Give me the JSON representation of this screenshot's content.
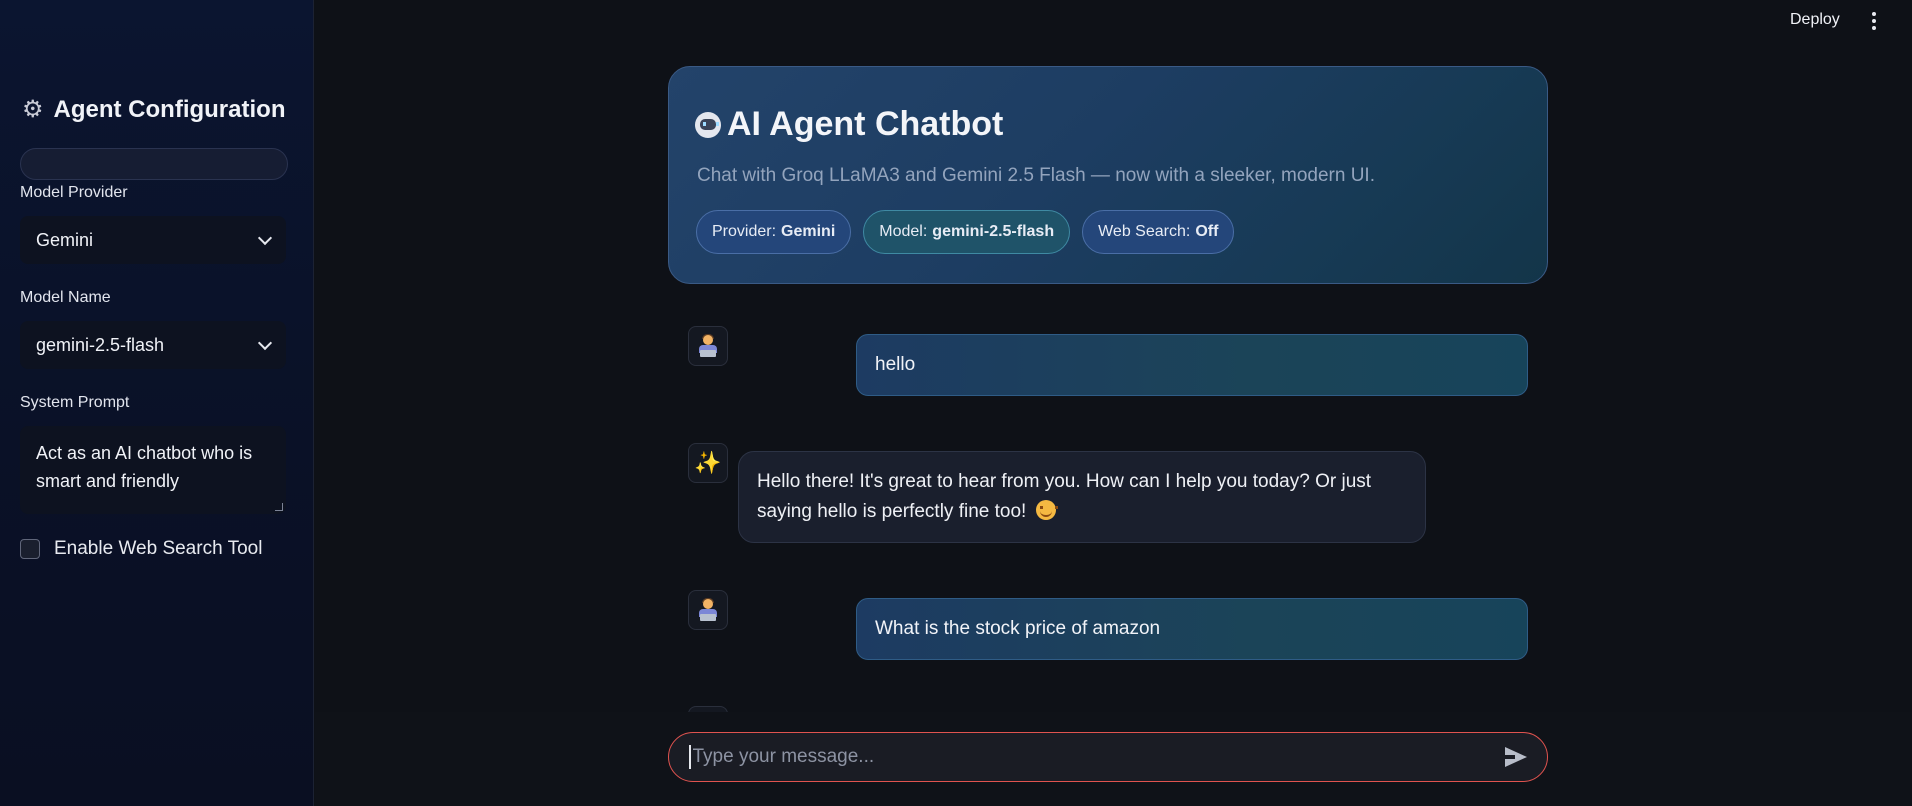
{
  "sidebar": {
    "title": "Agent Configuration",
    "title_icon": "gear-icon",
    "model_provider_label": "Model Provider",
    "model_provider_value": "Gemini",
    "model_name_label": "Model Name",
    "model_name_value": "gemini-2.5-flash",
    "system_prompt_label": "System Prompt",
    "system_prompt_value": "Act as an AI chatbot who is smart and friendly",
    "web_search_label": "Enable Web Search Tool",
    "web_search_checked": false
  },
  "topbar": {
    "deploy_label": "Deploy",
    "menu_icon": "kebab-menu-icon"
  },
  "hero": {
    "title_icon": "robot-icon",
    "title": "AI Agent Chatbot",
    "subtitle": "Chat with Groq LLaMA3 and Gemini 2.5 Flash — now with a sleeker, modern UI.",
    "badges": [
      {
        "label": "Provider:",
        "value": "Gemini"
      },
      {
        "label": "Model:",
        "value": "gemini-2.5-flash"
      },
      {
        "label": "Web Search:",
        "value": "Off"
      }
    ]
  },
  "messages": [
    {
      "role": "user",
      "avatar": "user-laptop-icon",
      "text": "hello"
    },
    {
      "role": "assistant",
      "avatar": "sparkles-icon",
      "text": "Hello there! It's great to hear from you. How can I help you today? Or just saying hello is perfectly fine too!",
      "emoji": "smiling-face-icon"
    },
    {
      "role": "user",
      "avatar": "user-laptop-icon",
      "text": "What is the stock price of amazon"
    }
  ],
  "chat_input": {
    "placeholder": "Type your message...",
    "value": "",
    "send_icon": "send-icon"
  },
  "colors": {
    "background": "#0e1117",
    "sidebar": "#0a1127",
    "accent_border": "#e0534f",
    "hero_gradient_start": "#23436a",
    "hero_gradient_end": "#133549"
  }
}
